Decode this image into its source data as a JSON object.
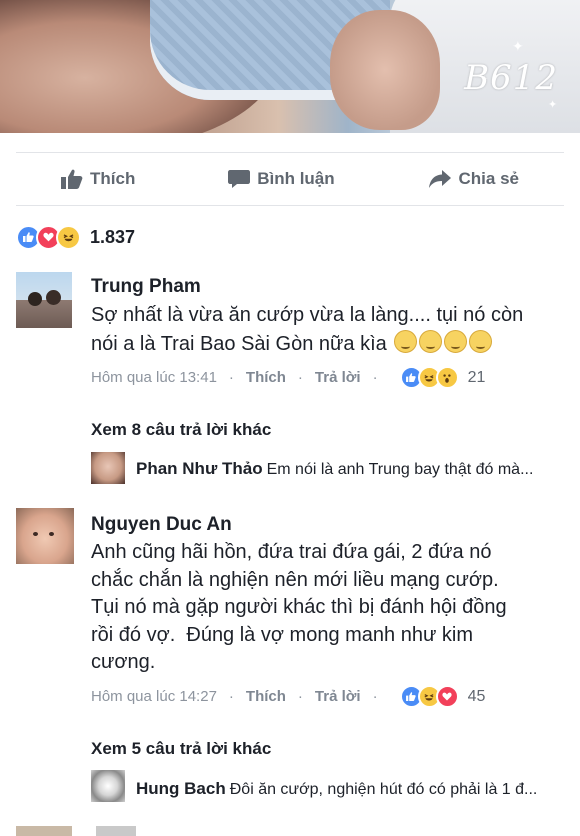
{
  "photo": {
    "watermark": "B612"
  },
  "actions": {
    "like_label": "Thích",
    "comment_label": "Bình luận",
    "share_label": "Chia sẻ"
  },
  "reactions": {
    "count": "1.837",
    "types": [
      "like",
      "love",
      "haha"
    ]
  },
  "comments": [
    {
      "name": "Trung Pham",
      "text_line1": "Sợ nhất là vừa ăn cướp vừa la làng.... tụi nó còn",
      "text_line2": "nói a là Trai Bao Sài Gòn nữa kìa",
      "emoji_count": 4,
      "time": "Hôm qua lúc 13:41",
      "like_label": "Thích",
      "reply_label": "Trả lời",
      "reaction_count": "21",
      "reaction_types": [
        "like",
        "haha",
        "wow"
      ],
      "more_replies": "Xem 8 câu trả lời khác",
      "reply_preview": {
        "name": "Phan Như Thảo",
        "text": "Em nói là anh Trung bay thật đó mà..."
      }
    },
    {
      "name": "Nguyen Duc An",
      "text_lines": [
        "Anh cũng hãi hồn, đứa trai đứa gái, 2 đứa nó",
        "chắc chắn là nghiện nên mới liều mạng cướp.",
        "Tụi nó mà gặp người khác thì bị đánh hội đồng",
        "rồi đó vợ.  Đúng là vợ mong manh như kim",
        "cương."
      ],
      "time": "Hôm qua lúc 14:27",
      "like_label": "Thích",
      "reply_label": "Trả lời",
      "reaction_count": "45",
      "reaction_types": [
        "like",
        "haha",
        "love"
      ],
      "more_replies": "Xem 5 câu trả lời khác",
      "reply_preview": {
        "name": "Hung Bach",
        "text": "Đôi ăn cướp, nghiện hút đó có phải là 1 đ..."
      }
    }
  ],
  "colors": {
    "like": "#4a8cf6",
    "love": "#f2405a",
    "haha": "#f7c843",
    "meta": "#8d949e",
    "action": "#606770"
  }
}
